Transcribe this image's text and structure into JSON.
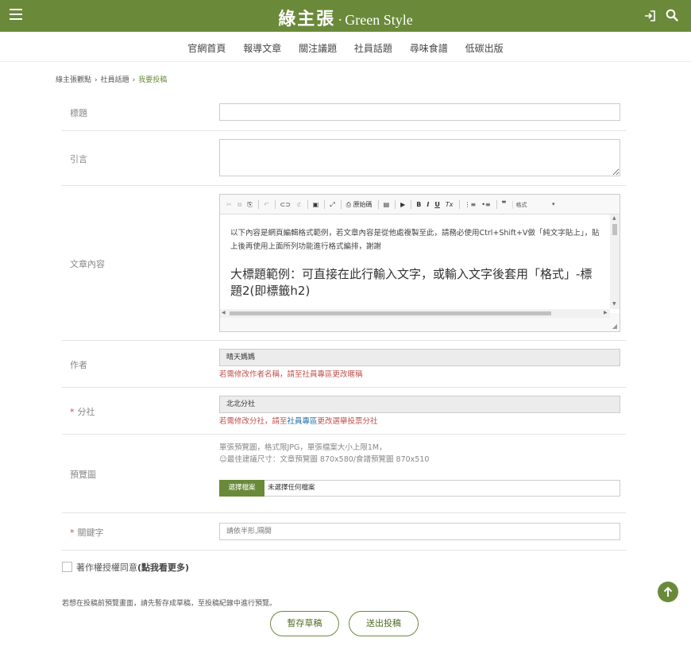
{
  "header": {
    "logo_cn": "綠主張",
    "logo_dot": "·",
    "logo_en": "Green Style"
  },
  "nav": [
    "官網首頁",
    "報導文章",
    "關注議題",
    "社員話題",
    "尋味食譜",
    "低碳出版"
  ],
  "breadcrumb": {
    "items": [
      "綠主張觀點",
      "社員話題"
    ],
    "current": "我要投稿",
    "separator": "›"
  },
  "form": {
    "title_label": "標題",
    "intro_label": "引言",
    "content_label": "文章內容",
    "author_label": "作者",
    "author_value": "晴天媽媽",
    "author_note": "若需修改作者名稱，請至社員專區更改暱稱",
    "branch_required": "*",
    "branch_label": "分社",
    "branch_value": "北北分社",
    "branch_note_pre": "若需修改分社，請至",
    "branch_note_link": "社員專區",
    "branch_note_post": "更改選舉投票分社",
    "preview_label": "預覽圖",
    "preview_note_1": "單張預覽圖，格式限JPG，單張檔案大小上限1M，",
    "preview_note_2": "☺最佳建議尺寸：文章預覽圖 870x580/食譜預覽圖 870x510",
    "file_button": "選擇檔案",
    "file_status": "未選擇任何檔案",
    "keyword_required": "*",
    "keyword_label": "關鍵字",
    "keyword_placeholder": "請依半形,隔開"
  },
  "editor": {
    "toolbar": {
      "cut": "✂",
      "copy": "⧉",
      "paste": "⎘",
      "undo": "↶",
      "link": "⊂⊃",
      "unlink": "⊄",
      "image": "▣",
      "maximize": "⤢",
      "source_icon": "⎙",
      "source": "原始碼",
      "template": "▤",
      "media": "▶",
      "bold": "B",
      "italic": "I",
      "underline": "U",
      "remove_format": "Tx",
      "numbered_list": "⋮≡",
      "bullet_list": "•≡",
      "blockquote": "❞",
      "format": "格式",
      "format_caret": "▾"
    },
    "content_paragraph": "以下內容是網頁編輯格式範例，若文章內容是從他處複製至此，請務必使用Ctrl+Shift+V做「純文字貼上」，貼上後再使用上面所列功能進行格式編排，謝謝",
    "content_heading": "大標題範例：可直接在此行輸入文字，或輸入文字後套用「格式」-標題2(即標籤h2)",
    "scroll_up": "▲",
    "scroll_down": "▼",
    "scroll_left": "◀",
    "scroll_right": "▶",
    "resize": "◢"
  },
  "copyright": {
    "label_pre": "著作權授權同意",
    "label_link": "(點我看更多)"
  },
  "hint": "若想在投稿前預覽畫面，請先暫存成草稿，至投稿紀錄中進行預覽。",
  "buttons": {
    "draft": "暫存草稿",
    "submit": "送出投稿"
  },
  "colors": {
    "brand": "#6a8a3a",
    "note_red": "#c0504d",
    "link_blue": "#1e6fa8"
  }
}
